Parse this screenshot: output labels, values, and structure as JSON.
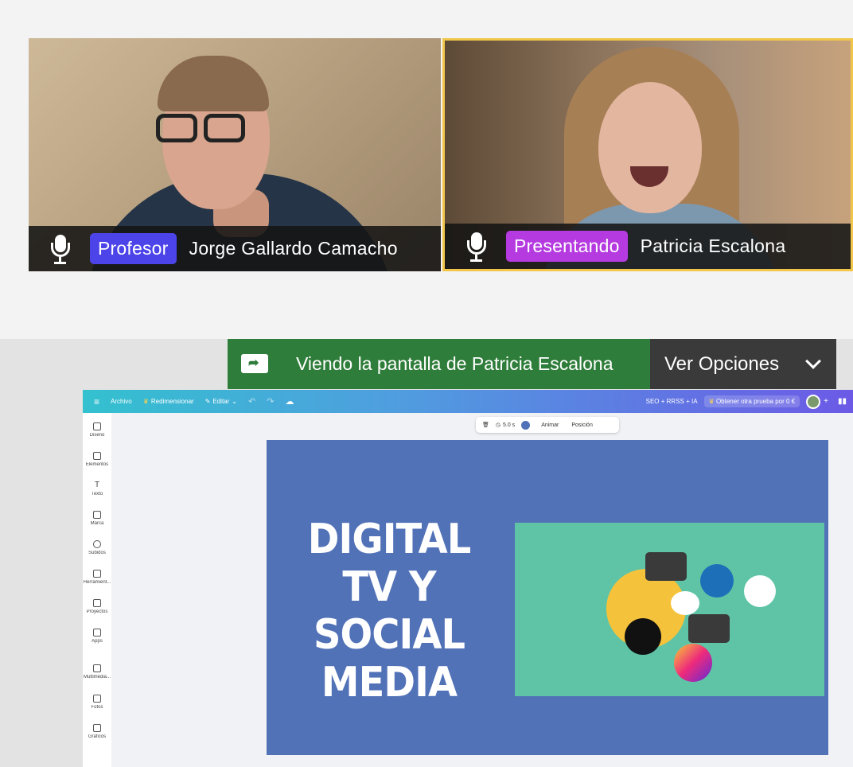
{
  "participants": [
    {
      "role": "Profesor",
      "name": "Jorge Gallardo Camacho",
      "role_color": "#4c44e8"
    },
    {
      "role": "Presentando",
      "name": "Patricia Escalona",
      "role_color": "#b53ae0",
      "active_border": "#f2c64b"
    }
  ],
  "share_banner": {
    "text": "Viendo la pantalla de Patricia Escalona",
    "options_label": "Ver Opciones"
  },
  "editor": {
    "menu": {
      "archivo": "Archivo",
      "redimensionar": "Redimensionar",
      "editar": "Editar"
    },
    "project_title": "SEO + RRSS + IA",
    "trial_button": "Obtener otra prueba por 0 €",
    "floating_toolbar": {
      "duration": "5.0 s",
      "animate": "Animar",
      "position": "Posición"
    },
    "sidebar": [
      {
        "label": "Diseño",
        "icon": "layout-icon"
      },
      {
        "label": "Elementos",
        "icon": "shapes-icon"
      },
      {
        "label": "Texto",
        "icon": "text-icon"
      },
      {
        "label": "Marca",
        "icon": "brand-icon"
      },
      {
        "label": "Subidos",
        "icon": "upload-icon"
      },
      {
        "label": "Herramient...",
        "icon": "tools-icon"
      },
      {
        "label": "Proyectos",
        "icon": "folder-icon"
      },
      {
        "label": "Apps",
        "icon": "apps-icon"
      },
      {
        "label": "Multimedia...",
        "icon": "media-icon"
      },
      {
        "label": "Fotos",
        "icon": "photo-icon"
      },
      {
        "label": "Gráficos",
        "icon": "chart-icon"
      }
    ],
    "slide": {
      "title_lines": [
        "DIGITAL",
        "TV Y",
        "SOCIAL",
        "MEDIA"
      ],
      "background": "#5272b8",
      "image_background": "#5fc4a6"
    }
  }
}
